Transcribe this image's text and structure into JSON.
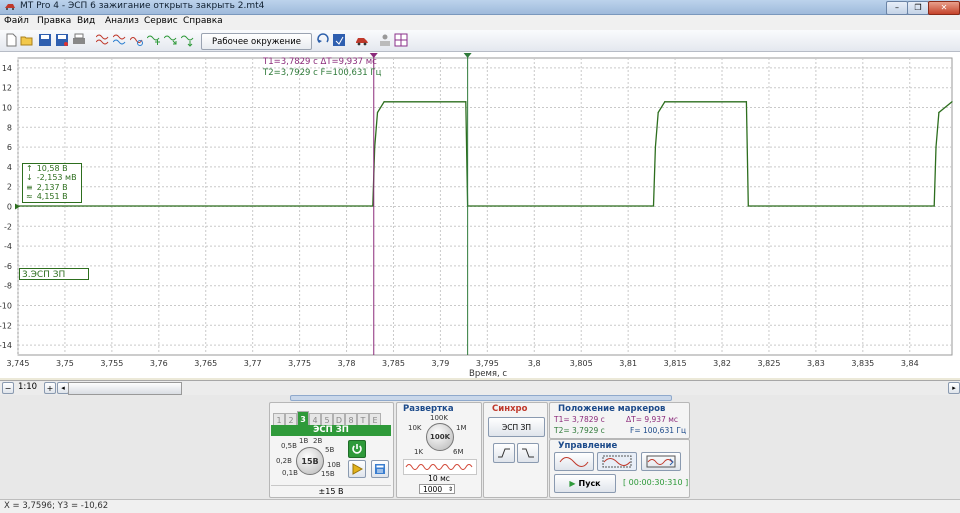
{
  "window": {
    "title": "MT Pro 4 - ЭСП 6 зажигание открыть закрыть 2.mt4",
    "controls": [
      "minimize",
      "maximize",
      "close"
    ]
  },
  "menu": [
    "Файл",
    "Правка",
    "Вид",
    "Анализ",
    "Сервис",
    "Справка"
  ],
  "toolbar": {
    "left_icons": [
      "new-file-icon",
      "open-folder-icon",
      "save-icon",
      "save-as-icon",
      "print-icon"
    ],
    "channel_icons": [
      "signals-icon",
      "signals-cross-icon",
      "signal-meas-icon",
      "signals-add-icon",
      "signals-export-icon",
      "signals-sort-icon"
    ],
    "workspace_label": "Рабочее окружение",
    "right_icons": [
      "undo-icon",
      "save-view-icon",
      "car-icon",
      "user-icon",
      "grid-icon"
    ]
  },
  "chart_data": {
    "type": "line",
    "xlabel": "Время, с",
    "ylabel": "",
    "xlim": [
      3.745,
      3.8445
    ],
    "ylim": [
      -15,
      15
    ],
    "x_ticks": [
      "3,745",
      "3,75",
      "3,755",
      "3,76",
      "3,765",
      "3,77",
      "3,775",
      "3,78",
      "3,785",
      "3,79",
      "3,795",
      "3,8",
      "3,805",
      "3,81",
      "3,815",
      "3,82",
      "3,825",
      "3,83",
      "3,835",
      "3,84"
    ],
    "y_ticks": [
      "14",
      "12",
      "10",
      "8",
      "6",
      "4",
      "2",
      "0",
      "-2",
      "-4",
      "-6",
      "-8",
      "-10",
      "-12",
      "-14"
    ],
    "grid": true,
    "series": [
      {
        "name": "3.ЭСП ЗП",
        "color": "#2d6e1e",
        "x": [
          3.745,
          3.7828,
          3.783,
          3.7833,
          3.784,
          3.7927,
          3.7929,
          3.8127,
          3.8129,
          3.8132,
          3.8139,
          3.8226,
          3.8228,
          3.8426,
          3.8428,
          3.8431,
          3.8445
        ],
        "y": [
          0.05,
          0.05,
          6.0,
          9.5,
          10.58,
          10.58,
          0.05,
          0.05,
          6.0,
          9.5,
          10.58,
          10.58,
          0.05,
          0.05,
          6.0,
          9.5,
          10.58
        ]
      }
    ],
    "markers": {
      "T1": {
        "x": 3.7829,
        "label": "T1=3,7829 с",
        "color": "#8b2a7a"
      },
      "T2": {
        "x": 3.7929,
        "label": "T2=3,7929 с",
        "color": "#2f7a3a"
      },
      "dT_label": "ΔT=9,937 мс",
      "F_label": "F=100,631 Гц"
    },
    "legend_box": {
      "rows": [
        {
          "icon": "max-arrow-icon",
          "text": "10,58 В"
        },
        {
          "icon": "min-arrow-icon",
          "text": "-2,153 мВ"
        },
        {
          "icon": "avg-icon",
          "text": "2,137 В"
        },
        {
          "icon": "rms-icon",
          "text": "4,151 В"
        }
      ]
    },
    "channel_label": "3.ЭСП ЗП"
  },
  "scrollbar": {
    "zoom_label": "1:10"
  },
  "channel_panel": {
    "tabs": [
      "1",
      "2",
      "3",
      "4",
      "5",
      "D",
      "8",
      "T",
      "E"
    ],
    "active_tab": "3",
    "header": "ЭСП ЗП",
    "knob_labels": [
      "0,5В",
      "1В",
      "2В",
      "5В",
      "10В",
      "15В",
      "0,2В",
      "0,1В"
    ],
    "knob_value": "15В",
    "range_label": "±15 В"
  },
  "sweep_panel": {
    "title": "Развертка",
    "knob_labels": [
      "100K",
      "10K",
      "1M",
      "1K",
      "6M"
    ],
    "knob_value": "100K",
    "time_div": "10 мс",
    "count": "1000"
  },
  "sync_panel": {
    "title": "Синхро",
    "source": "ЭСП ЗП"
  },
  "markers_panel": {
    "title": "Положение маркеров",
    "t1": "T1= 3,7829 с",
    "dt": "ΔT= 9,937 мс",
    "t2": "T2= 3,7929 с",
    "f": "F= 100,631 Гц"
  },
  "control_panel": {
    "title": "Управление",
    "start_label": "Пуск",
    "timer": "[ 00:00:30:310 ]"
  },
  "status": {
    "coords": "X = 3,7596; Y3 = -10,62"
  }
}
